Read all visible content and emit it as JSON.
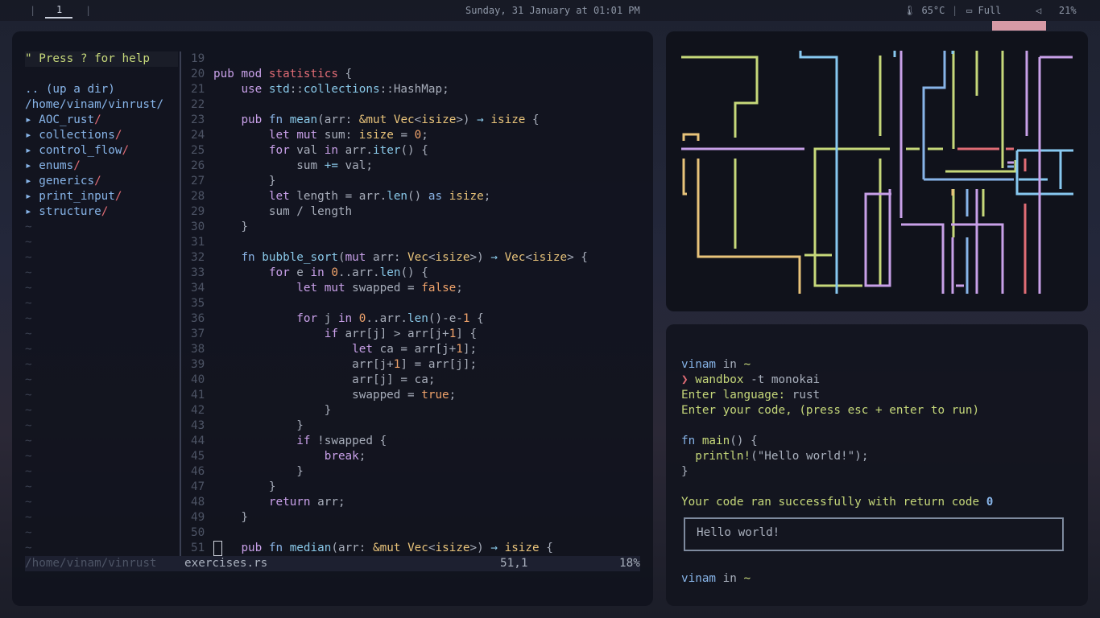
{
  "topbar": {
    "workspace": "1",
    "clock": "Sunday, 31 January at 01:01 PM",
    "temperature": "65°C",
    "battery": "Full",
    "volume": "21%"
  },
  "editor": {
    "tree": {
      "help": "\" Press ? for help",
      "up": ".. (up a dir)",
      "path": "/home/vinam/vinrust/",
      "dirs": [
        "AOC_rust",
        "collections",
        "control_flow",
        "enums",
        "generics",
        "print_input",
        "structure"
      ]
    },
    "status": {
      "tree_path": "/home/vinam/vinrust",
      "file": "exercises.rs",
      "position": "51,1",
      "percent": "18%"
    }
  },
  "terminal": {
    "prompt_user": "vinam",
    "prompt_in": "in",
    "prompt_dir": "~",
    "arrow": "❯",
    "command": "wandbox",
    "command_args": "-t monokai",
    "lang_prompt": "Enter language:",
    "lang_value": "rust",
    "code_prompt": "Enter your code, (press esc + enter to run)",
    "code_main": "main",
    "code_println": "println!",
    "code_string": "\"Hello world!\"",
    "result_text": "Your code ran successfully with return code",
    "result_code": "0",
    "output": "Hello world!"
  },
  "colors": {
    "accent_green": "#c6d87a",
    "accent_blue": "#87b4e8",
    "accent_red": "#e06c75",
    "accent_yellow": "#e8c37a",
    "accent_purple": "#c8a0e8"
  }
}
